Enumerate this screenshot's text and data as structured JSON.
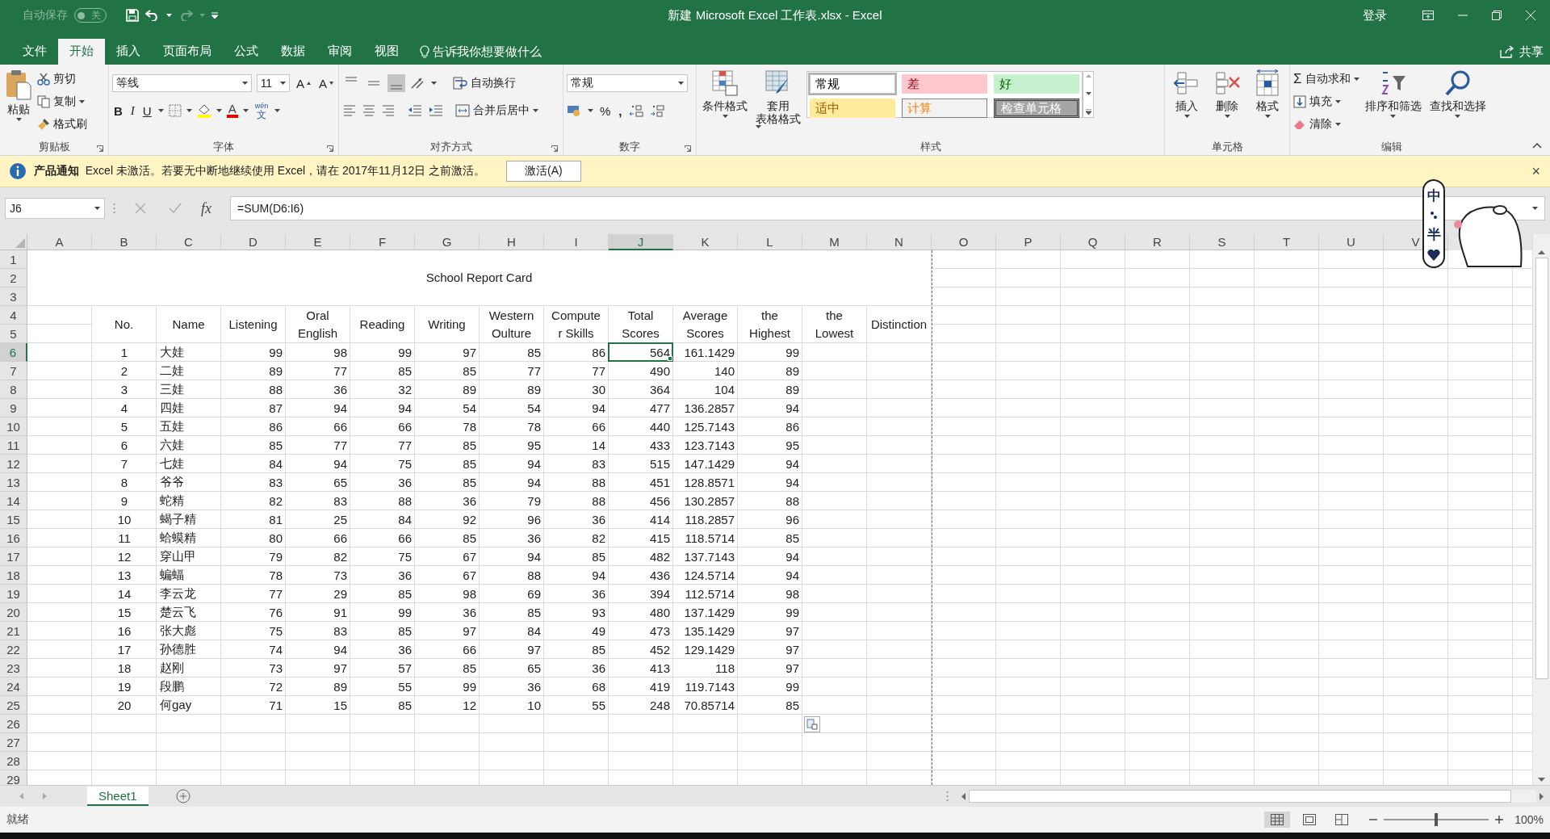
{
  "title_bar": {
    "autosave": {
      "label": "自动保存",
      "state_text": "关",
      "on": false
    },
    "title": "新建 Microsoft Excel 工作表.xlsx  -  Excel",
    "sign_in": "登录"
  },
  "ribbon_tabs": [
    {
      "label": "文件",
      "selected": false
    },
    {
      "label": "开始",
      "selected": true
    },
    {
      "label": "插入",
      "selected": false
    },
    {
      "label": "页面布局",
      "selected": false
    },
    {
      "label": "公式",
      "selected": false
    },
    {
      "label": "数据",
      "selected": false
    },
    {
      "label": "审阅",
      "selected": false
    },
    {
      "label": "视图",
      "selected": false
    }
  ],
  "tell_me": "告诉我你想要做什么",
  "share": "共享",
  "ribbon": {
    "clipboard": {
      "paste": "粘贴",
      "cut": "剪切",
      "copy": "复制",
      "format_painter": "格式刷",
      "label": "剪贴板"
    },
    "font": {
      "name": "等线",
      "size": "11",
      "grow": "A",
      "shrink": "A",
      "bold": "B",
      "italic": "I",
      "underline": "U",
      "font_color": "A",
      "phonetic_top": "wén",
      "phonetic_bottom": "文",
      "label": "字体"
    },
    "alignment": {
      "vertical": [
        {
          "selected": false
        },
        {
          "selected": false
        },
        {
          "selected": true
        }
      ],
      "wrap": "自动换行",
      "merge": "合并后居中",
      "label": "对齐方式"
    },
    "number": {
      "format": "常规",
      "percent": "%",
      "comma": ",",
      "label": "数字"
    },
    "styles": {
      "conditional": "条件格式",
      "table_format": [
        "套用",
        "表格格式"
      ],
      "gallery": [
        {
          "label": "常规",
          "kind": "normal",
          "selected": true
        },
        {
          "label": "差",
          "kind": "bad",
          "selected": false
        },
        {
          "label": "好",
          "kind": "good",
          "selected": false
        },
        {
          "label": "适中",
          "kind": "neutral",
          "selected": false
        },
        {
          "label": "计算",
          "kind": "calculation",
          "selected": false
        },
        {
          "label": "检查单元格",
          "kind": "check",
          "selected": false
        }
      ],
      "label": "样式"
    },
    "cells": {
      "insert": "插入",
      "delete": "删除",
      "format": "格式",
      "label": "单元格"
    },
    "editing": {
      "sum_symbol": "Σ",
      "autosum": "自动求和",
      "fill": "填充",
      "clear": "清除",
      "sort": "排序和筛选",
      "find": "查找和选择",
      "label": "编辑"
    }
  },
  "notification": {
    "title": "产品通知",
    "message": "Excel 未激活。若要无中断地继续使用 Excel，请在 2017年11月12日 之前激活。",
    "button": "激活(A)",
    "close": "×"
  },
  "formula_bar": {
    "name_box": "J6",
    "fx": "fx",
    "formula": "=SUM(D6:I6)"
  },
  "ime_toolbar": {
    "mode": "中",
    "width": "半"
  },
  "sheet": {
    "columns": [
      {
        "label": "A",
        "selected": false
      },
      {
        "label": "B",
        "selected": false
      },
      {
        "label": "C",
        "selected": false
      },
      {
        "label": "D",
        "selected": false
      },
      {
        "label": "E",
        "selected": false
      },
      {
        "label": "F",
        "selected": false
      },
      {
        "label": "G",
        "selected": false
      },
      {
        "label": "H",
        "selected": false
      },
      {
        "label": "I",
        "selected": false
      },
      {
        "label": "J",
        "selected": true
      },
      {
        "label": "K",
        "selected": false
      },
      {
        "label": "L",
        "selected": false
      },
      {
        "label": "M",
        "selected": false
      },
      {
        "label": "N",
        "selected": false
      },
      {
        "label": "O",
        "selected": false
      },
      {
        "label": "P",
        "selected": false
      },
      {
        "label": "Q",
        "selected": false
      },
      {
        "label": "R",
        "selected": false
      },
      {
        "label": "S",
        "selected": false
      },
      {
        "label": "T",
        "selected": false
      },
      {
        "label": "U",
        "selected": false
      },
      {
        "label": "V",
        "selected": false
      }
    ],
    "row_numbers": [
      {
        "label": "1",
        "selected": false
      },
      {
        "label": "2",
        "selected": false
      },
      {
        "label": "3",
        "selected": false
      },
      {
        "label": "4",
        "selected": false
      },
      {
        "label": "5",
        "selected": false
      },
      {
        "label": "6",
        "selected": true
      },
      {
        "label": "7",
        "selected": false
      },
      {
        "label": "8",
        "selected": false
      },
      {
        "label": "9",
        "selected": false
      },
      {
        "label": "10",
        "selected": false
      },
      {
        "label": "11",
        "selected": false
      },
      {
        "label": "12",
        "selected": false
      },
      {
        "label": "13",
        "selected": false
      },
      {
        "label": "14",
        "selected": false
      },
      {
        "label": "15",
        "selected": false
      },
      {
        "label": "16",
        "selected": false
      },
      {
        "label": "17",
        "selected": false
      },
      {
        "label": "18",
        "selected": false
      },
      {
        "label": "19",
        "selected": false
      },
      {
        "label": "20",
        "selected": false
      },
      {
        "label": "21",
        "selected": false
      },
      {
        "label": "22",
        "selected": false
      },
      {
        "label": "23",
        "selected": false
      },
      {
        "label": "24",
        "selected": false
      },
      {
        "label": "25",
        "selected": false
      },
      {
        "label": "26",
        "selected": false
      },
      {
        "label": "27",
        "selected": false
      },
      {
        "label": "28",
        "selected": false
      },
      {
        "label": "29",
        "selected": false
      }
    ],
    "title": "School Report Card",
    "headers": [
      [
        "No."
      ],
      [
        "Name"
      ],
      [
        "Listening"
      ],
      [
        "Oral",
        "English"
      ],
      [
        "Reading"
      ],
      [
        "Writing"
      ],
      [
        "Western",
        "Oulture"
      ],
      [
        "Compute",
        "r Skills"
      ],
      [
        "Total",
        "Scores"
      ],
      [
        "Average",
        "Scores"
      ],
      [
        "the",
        "Highest"
      ],
      [
        "the",
        "Lowest"
      ],
      [
        "Distinction"
      ]
    ],
    "rows": [
      [
        "",
        "1",
        "大娃",
        "99",
        "98",
        "99",
        "97",
        "85",
        "86",
        "564",
        "161.1429",
        "99"
      ],
      [
        "",
        "2",
        "二娃",
        "89",
        "77",
        "85",
        "85",
        "77",
        "77",
        "490",
        "140",
        "89"
      ],
      [
        "",
        "3",
        "三娃",
        "88",
        "36",
        "32",
        "89",
        "89",
        "30",
        "364",
        "104",
        "89"
      ],
      [
        "",
        "4",
        "四娃",
        "87",
        "94",
        "94",
        "54",
        "54",
        "94",
        "477",
        "136.2857",
        "94"
      ],
      [
        "",
        "5",
        "五娃",
        "86",
        "66",
        "66",
        "78",
        "78",
        "66",
        "440",
        "125.7143",
        "86"
      ],
      [
        "",
        "6",
        "六娃",
        "85",
        "77",
        "77",
        "85",
        "95",
        "14",
        "433",
        "123.7143",
        "95"
      ],
      [
        "",
        "7",
        "七娃",
        "84",
        "94",
        "75",
        "85",
        "94",
        "83",
        "515",
        "147.1429",
        "94"
      ],
      [
        "",
        "8",
        "爷爷",
        "83",
        "65",
        "36",
        "85",
        "94",
        "88",
        "451",
        "128.8571",
        "94"
      ],
      [
        "",
        "9",
        "蛇精",
        "82",
        "83",
        "88",
        "36",
        "79",
        "88",
        "456",
        "130.2857",
        "88"
      ],
      [
        "",
        "10",
        "蝎子精",
        "81",
        "25",
        "84",
        "92",
        "96",
        "36",
        "414",
        "118.2857",
        "96"
      ],
      [
        "",
        "11",
        "蛤蟆精",
        "80",
        "66",
        "66",
        "85",
        "36",
        "82",
        "415",
        "118.5714",
        "85"
      ],
      [
        "",
        "12",
        "穿山甲",
        "79",
        "82",
        "75",
        "67",
        "94",
        "85",
        "482",
        "137.7143",
        "94"
      ],
      [
        "",
        "13",
        "蝙蝠",
        "78",
        "73",
        "36",
        "67",
        "88",
        "94",
        "436",
        "124.5714",
        "94"
      ],
      [
        "",
        "14",
        "李云龙",
        "77",
        "29",
        "85",
        "98",
        "69",
        "36",
        "394",
        "112.5714",
        "98"
      ],
      [
        "",
        "15",
        "楚云飞",
        "76",
        "91",
        "99",
        "36",
        "85",
        "93",
        "480",
        "137.1429",
        "99"
      ],
      [
        "",
        "16",
        "张大彪",
        "75",
        "83",
        "85",
        "97",
        "84",
        "49",
        "473",
        "135.1429",
        "97"
      ],
      [
        "",
        "17",
        "孙德胜",
        "74",
        "94",
        "36",
        "66",
        "97",
        "85",
        "452",
        "129.1429",
        "97"
      ],
      [
        "",
        "18",
        "赵刚",
        "73",
        "97",
        "57",
        "85",
        "65",
        "36",
        "413",
        "118",
        "97"
      ],
      [
        "",
        "19",
        "段鹏",
        "72",
        "89",
        "55",
        "99",
        "36",
        "68",
        "419",
        "119.7143",
        "99"
      ],
      [
        "",
        "20",
        "何gay",
        "71",
        "15",
        "85",
        "12",
        "10",
        "55",
        "248",
        "70.85714",
        "85"
      ]
    ]
  },
  "sheet_tabs": [
    {
      "label": "Sheet1",
      "selected": true
    }
  ],
  "status_bar": {
    "status": "就绪",
    "zoom": {
      "level": 0.5,
      "reading": "100%"
    }
  }
}
